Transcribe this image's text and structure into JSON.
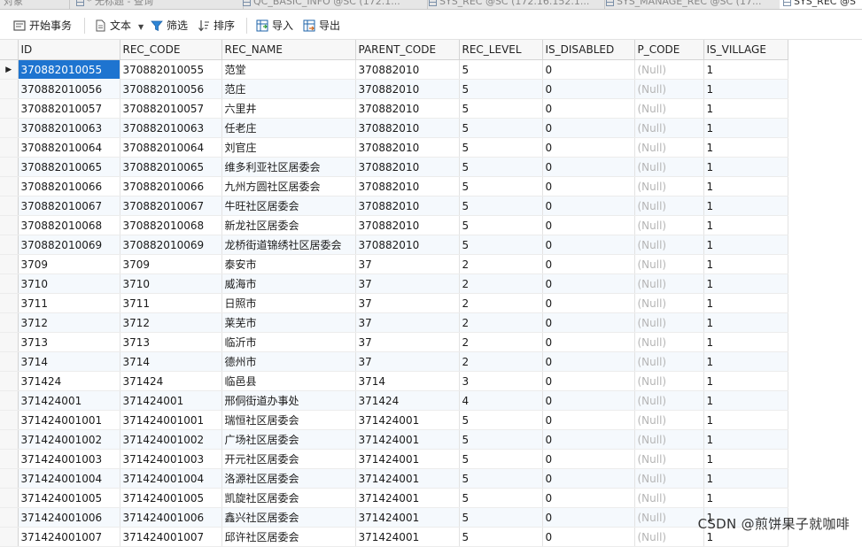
{
  "tabs": [
    {
      "label": "对象",
      "active": false
    },
    {
      "label": "* 无标题 - 查询",
      "active": false
    },
    {
      "label": "QC_BASIC_INFO @SC (172.1...",
      "active": false
    },
    {
      "label": "SYS_REC @SC (172.16.152.1...",
      "active": false
    },
    {
      "label": "SYS_MANAGE_REC @SC (17...",
      "active": false
    },
    {
      "label": "SYS_REC @S",
      "active": true
    }
  ],
  "toolbar": {
    "begin_transaction": "开始事务",
    "text": "文本",
    "filter": "筛选",
    "sort": "排序",
    "import": "导入",
    "export": "导出"
  },
  "table": {
    "columns": [
      "ID",
      "REC_CODE",
      "REC_NAME",
      "PARENT_CODE",
      "REC_LEVEL",
      "IS_DISABLED",
      "P_CODE",
      "IS_VILLAGE"
    ],
    "rows": [
      [
        "370882010055",
        "370882010055",
        "范堂",
        "370882010",
        "5",
        "0",
        "(Null)",
        "1"
      ],
      [
        "370882010056",
        "370882010056",
        "范庄",
        "370882010",
        "5",
        "0",
        "(Null)",
        "1"
      ],
      [
        "370882010057",
        "370882010057",
        "六里井",
        "370882010",
        "5",
        "0",
        "(Null)",
        "1"
      ],
      [
        "370882010063",
        "370882010063",
        "任老庄",
        "370882010",
        "5",
        "0",
        "(Null)",
        "1"
      ],
      [
        "370882010064",
        "370882010064",
        "刘官庄",
        "370882010",
        "5",
        "0",
        "(Null)",
        "1"
      ],
      [
        "370882010065",
        "370882010065",
        "维多利亚社区居委会",
        "370882010",
        "5",
        "0",
        "(Null)",
        "1"
      ],
      [
        "370882010066",
        "370882010066",
        "九州方圆社区居委会",
        "370882010",
        "5",
        "0",
        "(Null)",
        "1"
      ],
      [
        "370882010067",
        "370882010067",
        "牛旺社区居委会",
        "370882010",
        "5",
        "0",
        "(Null)",
        "1"
      ],
      [
        "370882010068",
        "370882010068",
        "新龙社区居委会",
        "370882010",
        "5",
        "0",
        "(Null)",
        "1"
      ],
      [
        "370882010069",
        "370882010069",
        "龙桥街道锦绣社区居委会",
        "370882010",
        "5",
        "0",
        "(Null)",
        "1"
      ],
      [
        "3709",
        "3709",
        "泰安市",
        "37",
        "2",
        "0",
        "(Null)",
        "1"
      ],
      [
        "3710",
        "3710",
        "威海市",
        "37",
        "2",
        "0",
        "(Null)",
        "1"
      ],
      [
        "3711",
        "3711",
        "日照市",
        "37",
        "2",
        "0",
        "(Null)",
        "1"
      ],
      [
        "3712",
        "3712",
        "莱芜市",
        "37",
        "2",
        "0",
        "(Null)",
        "1"
      ],
      [
        "3713",
        "3713",
        "临沂市",
        "37",
        "2",
        "0",
        "(Null)",
        "1"
      ],
      [
        "3714",
        "3714",
        "德州市",
        "37",
        "2",
        "0",
        "(Null)",
        "1"
      ],
      [
        "371424",
        "371424",
        "临邑县",
        "3714",
        "3",
        "0",
        "(Null)",
        "1"
      ],
      [
        "371424001",
        "371424001",
        "邢侗街道办事处",
        "371424",
        "4",
        "0",
        "(Null)",
        "1"
      ],
      [
        "371424001001",
        "371424001001",
        "瑞恒社区居委会",
        "371424001",
        "5",
        "0",
        "(Null)",
        "1"
      ],
      [
        "371424001002",
        "371424001002",
        "广场社区居委会",
        "371424001",
        "5",
        "0",
        "(Null)",
        "1"
      ],
      [
        "371424001003",
        "371424001003",
        "开元社区居委会",
        "371424001",
        "5",
        "0",
        "(Null)",
        "1"
      ],
      [
        "371424001004",
        "371424001004",
        "洛源社区居委会",
        "371424001",
        "5",
        "0",
        "(Null)",
        "1"
      ],
      [
        "371424001005",
        "371424001005",
        "凯旋社区居委会",
        "371424001",
        "5",
        "0",
        "(Null)",
        "1"
      ],
      [
        "371424001006",
        "371424001006",
        "鑫兴社区居委会",
        "371424001",
        "5",
        "0",
        "(Null)",
        "1"
      ],
      [
        "371424001007",
        "371424001007",
        "邱许社区居委会",
        "371424001",
        "5",
        "0",
        "(Null)",
        "1"
      ]
    ],
    "current_row_marker": "▶"
  },
  "watermark": "CSDN @煎饼果子就咖啡",
  "colors": {
    "selection": "#1e74d0",
    "null_text": "#b5b5b5",
    "alt_row": "#f5f9fd"
  }
}
